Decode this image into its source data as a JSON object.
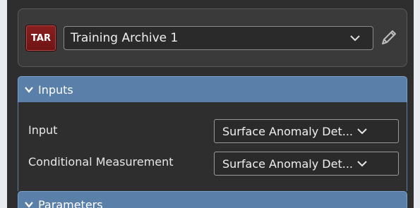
{
  "archive": {
    "badge": "TAR",
    "selected": "Training Archive 1"
  },
  "sections": {
    "inputs": {
      "title": "Inputs",
      "rows": [
        {
          "label": "Input",
          "value": "Surface Anomaly Det..."
        },
        {
          "label": "Conditional Measurement",
          "value": "Surface Anomaly Det..."
        }
      ]
    },
    "parameters": {
      "title": "Parameters"
    }
  },
  "colors": {
    "panel_bg": "#2e2e2e",
    "section_header": "#5a7fa8",
    "badge_red": "#8a1f1f"
  },
  "icons": {
    "badge": "tar-icon",
    "dropdown": "chevron-down-icon",
    "edit": "pencil-icon",
    "section_toggle": "chevron-down-icon"
  }
}
